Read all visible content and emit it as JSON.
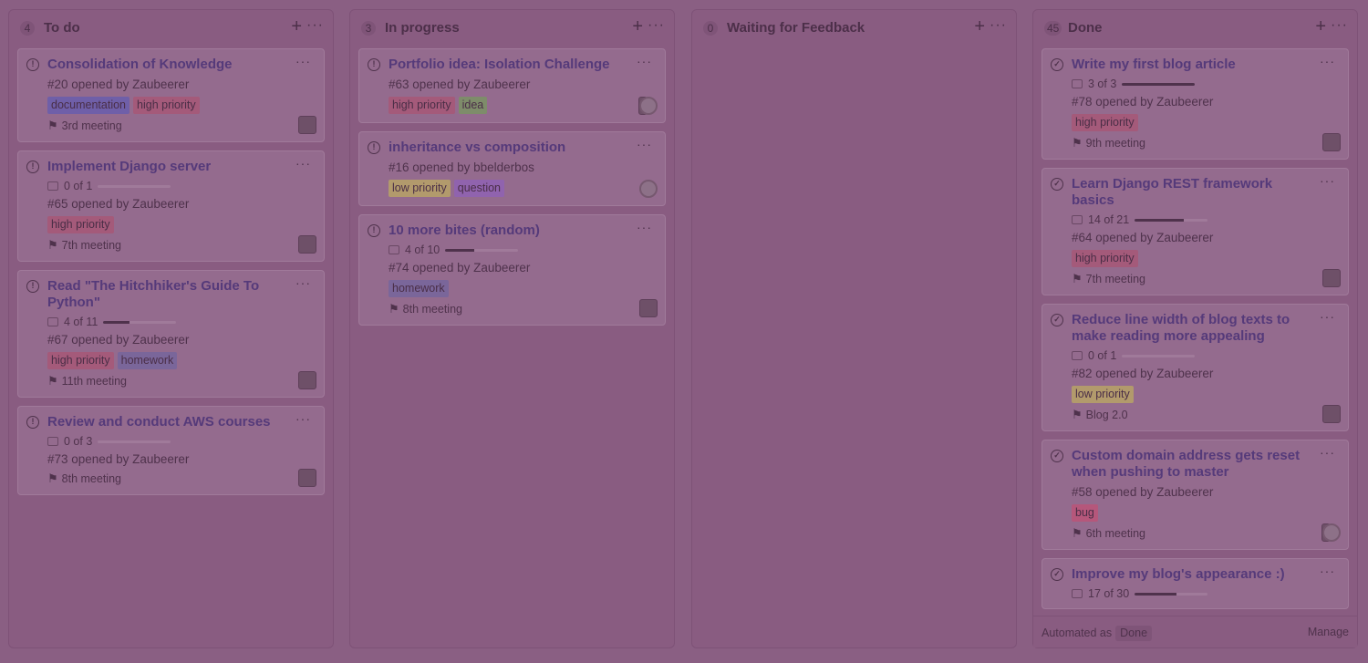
{
  "colors": {
    "label_high_priority": "#a45a7a",
    "label_documentation": "#6f5fa8",
    "label_homework": "#7a669a",
    "label_idea": "#7e8c6a",
    "label_low_priority": "#b29a6c",
    "label_question": "#9063ae",
    "label_bug": "#b5577b"
  },
  "columns": [
    {
      "count": "4",
      "title": "To do",
      "cards": [
        {
          "title": "Consolidation of Knowledge",
          "meta": "#20 opened by Zaubeerer",
          "labels": [
            {
              "text": "documentation",
              "color": "label_documentation"
            },
            {
              "text": "high priority",
              "color": "label_high_priority"
            }
          ],
          "milestone": "3rd meeting",
          "avatars": [
            "square"
          ]
        },
        {
          "title": "Implement Django server",
          "checklist": "0 of 1",
          "progress": 0,
          "meta": "#65 opened by Zaubeerer",
          "labels": [
            {
              "text": "high priority",
              "color": "label_high_priority"
            }
          ],
          "milestone": "7th meeting",
          "avatars": [
            "square"
          ]
        },
        {
          "title": "Read \"The Hitchhiker's Guide To Python\"",
          "checklist": "4 of 11",
          "progress": 0.36,
          "meta": "#67 opened by Zaubeerer",
          "labels": [
            {
              "text": "high priority",
              "color": "label_high_priority"
            },
            {
              "text": "homework",
              "color": "label_homework"
            }
          ],
          "milestone": "11th meeting",
          "avatars": [
            "square"
          ]
        },
        {
          "title": "Review and conduct AWS courses",
          "checklist": "0 of 3",
          "progress": 0,
          "meta": "#73 opened by Zaubeerer",
          "labels": [],
          "milestone": "8th meeting",
          "avatars": [
            "square"
          ]
        }
      ]
    },
    {
      "count": "3",
      "title": "In progress",
      "cards": [
        {
          "title": "Portfolio idea: Isolation Challenge",
          "meta": "#63 opened by Zaubeerer",
          "labels": [
            {
              "text": "high priority",
              "color": "label_high_priority"
            },
            {
              "text": "idea",
              "color": "label_idea"
            }
          ],
          "avatars": [
            "narrow",
            "circle"
          ]
        },
        {
          "title": "inheritance vs composition",
          "meta": "#16 opened by bbelderbos",
          "labels": [
            {
              "text": "low priority",
              "color": "label_low_priority"
            },
            {
              "text": "question",
              "color": "label_question"
            }
          ],
          "avatars": [
            "circle"
          ]
        },
        {
          "title": "10 more bites (random)",
          "checklist": "4 of 10",
          "progress": 0.4,
          "meta": "#74 opened by Zaubeerer",
          "labels": [
            {
              "text": "homework",
              "color": "label_homework"
            }
          ],
          "milestone": "8th meeting",
          "avatars": [
            "square"
          ]
        }
      ]
    },
    {
      "count": "0",
      "title": "Waiting for Feedback",
      "cards": []
    },
    {
      "count": "45",
      "title": "Done",
      "cards": [
        {
          "title": "Write my first blog article",
          "checklist": "3 of 3",
          "progress": 1,
          "meta": "#78 opened by Zaubeerer",
          "labels": [
            {
              "text": "high priority",
              "color": "label_high_priority"
            }
          ],
          "milestone": "9th meeting",
          "avatars": [
            "square"
          ]
        },
        {
          "title": "Learn Django REST framework basics",
          "checklist": "14 of 21",
          "progress": 0.67,
          "meta": "#64 opened by Zaubeerer",
          "labels": [
            {
              "text": "high priority",
              "color": "label_high_priority"
            }
          ],
          "milestone": "7th meeting",
          "avatars": [
            "square"
          ]
        },
        {
          "title": "Reduce line width of blog texts to make reading more appealing",
          "checklist": "0 of 1",
          "progress": 0,
          "meta": "#82 opened by Zaubeerer",
          "labels": [
            {
              "text": "low priority",
              "color": "label_low_priority"
            }
          ],
          "milestone": "Blog 2.0",
          "avatars": [
            "square"
          ]
        },
        {
          "title": "Custom domain address gets reset when pushing to master",
          "meta": "#58 opened by Zaubeerer",
          "labels": [
            {
              "text": "bug",
              "color": "label_bug"
            }
          ],
          "milestone": "6th meeting",
          "avatars": [
            "narrow",
            "circle"
          ]
        },
        {
          "title": "Improve my blog's appearance :)",
          "checklist": "17 of 30",
          "progress": 0.57,
          "meta": "",
          "labels": [],
          "avatars": []
        }
      ],
      "footer": {
        "automated_label": "Automated as",
        "automated_value": "Done",
        "manage_label": "Manage"
      }
    }
  ]
}
